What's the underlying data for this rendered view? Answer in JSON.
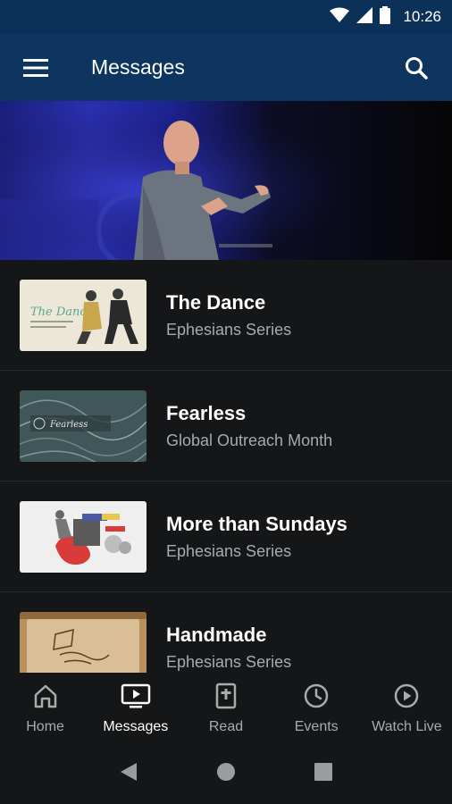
{
  "status_bar": {
    "time": "10:26",
    "icons": [
      "wifi-icon",
      "signal-icon",
      "battery-icon"
    ]
  },
  "app_bar": {
    "title": "Messages",
    "menu_icon": "menu-icon",
    "search_icon": "search-icon"
  },
  "messages": [
    {
      "title": "The Dance",
      "subtitle": "Ephesians Series"
    },
    {
      "title": "Fearless",
      "subtitle": "Global Outreach Month"
    },
    {
      "title": "More than Sundays",
      "subtitle": "Ephesians Series"
    },
    {
      "title": "Handmade",
      "subtitle": "Ephesians Series"
    }
  ],
  "bottom_nav": [
    {
      "label": "Home",
      "icon": "home-icon"
    },
    {
      "label": "Messages",
      "icon": "tv-icon",
      "active": true
    },
    {
      "label": "Read",
      "icon": "bible-icon"
    },
    {
      "label": "Events",
      "icon": "clock-icon"
    },
    {
      "label": "Watch Live",
      "icon": "play-circle-icon"
    }
  ],
  "system_nav": [
    "back-icon",
    "home-circle-icon",
    "recents-icon"
  ],
  "colors": {
    "app_bar": "#0d3560",
    "background": "#151617",
    "subtitle": "#a8aaad",
    "inactive_nav": "#a9abad"
  }
}
